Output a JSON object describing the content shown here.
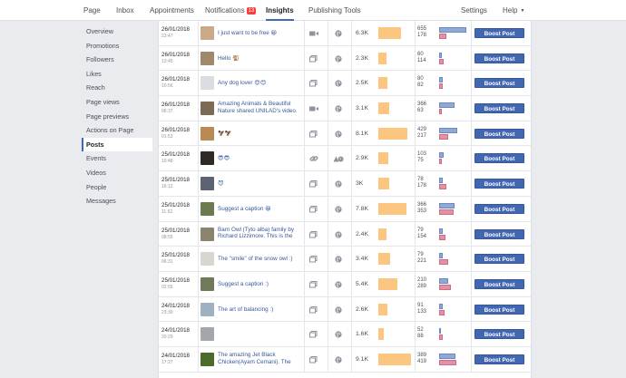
{
  "topnav": {
    "page": "Page",
    "inbox": "Inbox",
    "appointments": "Appointments",
    "notifications": "Notifications",
    "notifications_count": "13",
    "insights": "Insights",
    "publishing_tools": "Publishing Tools",
    "settings": "Settings",
    "help": "Help"
  },
  "sidebar": {
    "items": [
      "Overview",
      "Promotions",
      "Followers",
      "Likes",
      "Reach",
      "Page views",
      "Page previews",
      "Actions on Page",
      "Posts",
      "Events",
      "Videos",
      "People",
      "Messages"
    ],
    "active_index": 8
  },
  "boost_label": "Boost Post",
  "posts": [
    {
      "date": "26/01/2018",
      "time": "23:47",
      "text": "I just want to be free 😀",
      "type": "video-icon",
      "reach": "6.3K",
      "reach_num": 6300,
      "a": "655",
      "b": "178",
      "a_num": 655,
      "b_num": 178,
      "thumb": "#c9a989"
    },
    {
      "date": "26/01/2018",
      "time": "13:45",
      "text": "Hello 🐒",
      "type": "gallery-icon",
      "reach": "2.3K",
      "reach_num": 2300,
      "a": "60",
      "b": "114",
      "a_num": 60,
      "b_num": 114,
      "thumb": "#a0896a"
    },
    {
      "date": "26/01/2018",
      "time": "10:56",
      "text": "Any dog lover 😍😍",
      "type": "gallery-icon",
      "reach": "2.5K",
      "reach_num": 2500,
      "a": "80",
      "b": "82",
      "a_num": 80,
      "b_num": 82,
      "thumb": "#dadde2"
    },
    {
      "date": "26/01/2018",
      "time": "06:37",
      "text": "Amazing Animals & Beautiful Nature shared UNILAD's video.",
      "type": "video-icon",
      "reach": "3.1K",
      "reach_num": 3100,
      "a": "366",
      "b": "63",
      "a_num": 366,
      "b_num": 63,
      "thumb": "#7d6a55"
    },
    {
      "date": "26/01/2018",
      "time": "01:53",
      "text": "🦅🦅",
      "type": "gallery-icon",
      "reach": "8.1K",
      "reach_num": 8100,
      "a": "429",
      "b": "217",
      "a_num": 429,
      "b_num": 217,
      "thumb": "#b98a52"
    },
    {
      "date": "25/01/2018",
      "time": "19:48",
      "text": "😎😎",
      "type": "link-icon",
      "reach": "2.9K",
      "reach_num": 2900,
      "a": "103",
      "b": "75",
      "a_num": 103,
      "b_num": 75,
      "thumb": "#2e2a26"
    },
    {
      "date": "25/01/2018",
      "time": "16:12",
      "text": "😈",
      "type": "gallery-icon",
      "reach": "3K",
      "reach_num": 3000,
      "a": "78",
      "b": "178",
      "a_num": 78,
      "b_num": 178,
      "thumb": "#5b6470"
    },
    {
      "date": "25/01/2018",
      "time": "11:52",
      "text": "Suggest a caption 😀",
      "type": "gallery-icon",
      "reach": "7.8K",
      "reach_num": 7800,
      "a": "366",
      "b": "353",
      "a_num": 366,
      "b_num": 353,
      "thumb": "#6b7a50"
    },
    {
      "date": "25/01/2018",
      "time": "08:55",
      "text": "Barn Owl (Tyto alba) family by Richard Lizzimore. This is the",
      "type": "gallery-icon",
      "reach": "2.4K",
      "reach_num": 2400,
      "a": "79",
      "b": "154",
      "a_num": 79,
      "b_num": 154,
      "thumb": "#8d8470"
    },
    {
      "date": "25/01/2018",
      "time": "06:31",
      "text": "The \"smile\" of the snow owl :)",
      "type": "gallery-icon",
      "reach": "3.4K",
      "reach_num": 3400,
      "a": "79",
      "b": "221",
      "a_num": 79,
      "b_num": 221,
      "thumb": "#d9d6cf"
    },
    {
      "date": "25/01/2018",
      "time": "02:55",
      "text": "Suggest a caption :)",
      "type": "gallery-icon",
      "reach": "5.4K",
      "reach_num": 5400,
      "a": "210",
      "b": "289",
      "a_num": 210,
      "b_num": 289,
      "thumb": "#6f7a5a"
    },
    {
      "date": "24/01/2018",
      "time": "23:30",
      "text": "The art of balancing :)",
      "type": "gallery-icon",
      "reach": "2.6K",
      "reach_num": 2600,
      "a": "91",
      "b": "133",
      "a_num": 91,
      "b_num": 133,
      "thumb": "#9eb1c2"
    },
    {
      "date": "24/01/2018",
      "time": "20:29",
      "text": "",
      "type": "gallery-icon",
      "reach": "1.6K",
      "reach_num": 1600,
      "a": "52",
      "b": "88",
      "a_num": 52,
      "b_num": 88,
      "thumb": "#a3a7ad"
    },
    {
      "date": "24/01/2018",
      "time": "17:27",
      "text": "The amazing Jet Black Chicken(Ayam Cemani). The",
      "type": "gallery-icon",
      "reach": "9.1K",
      "reach_num": 9100,
      "a": "389",
      "b": "419",
      "a_num": 389,
      "b_num": 419,
      "thumb": "#4a6b2a"
    }
  ]
}
